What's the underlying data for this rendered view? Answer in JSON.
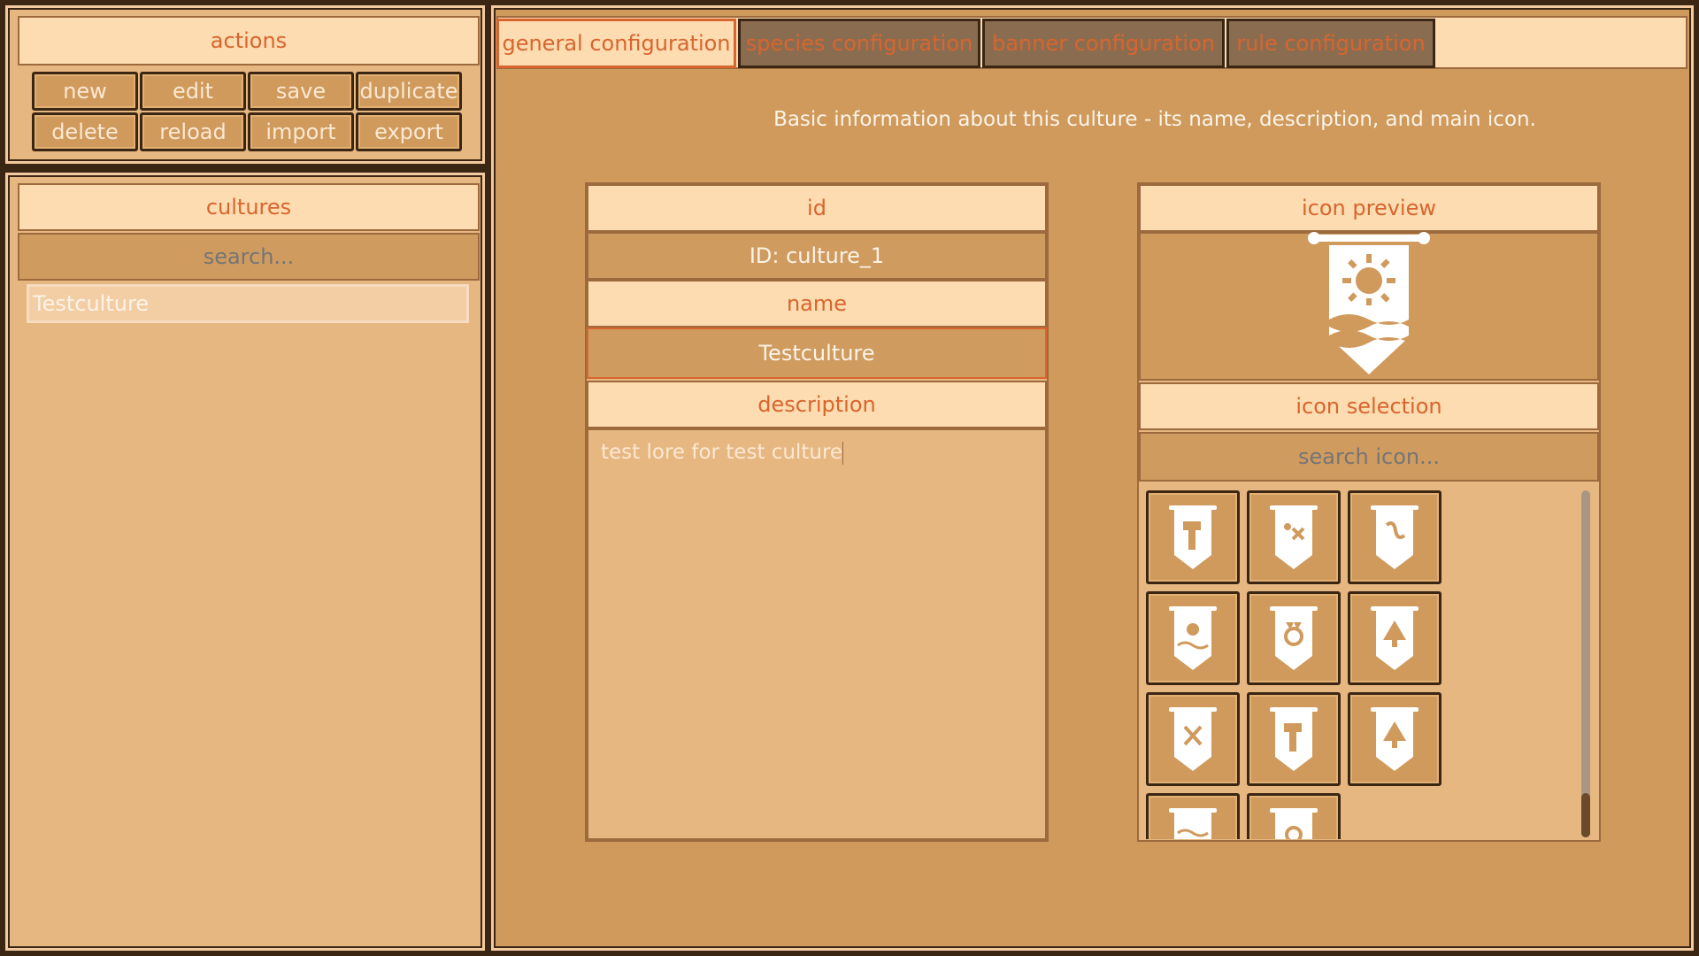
{
  "actions": {
    "title": "actions",
    "buttons": [
      "new",
      "edit",
      "save",
      "duplicate",
      "delete",
      "reload",
      "import",
      "export"
    ]
  },
  "cultures": {
    "title": "cultures",
    "search_placeholder": "search...",
    "items": [
      "Testculture"
    ]
  },
  "tabs": [
    "general configuration",
    "species configuration",
    "banner configuration",
    "rule configuration"
  ],
  "general": {
    "info_text": "Basic information about this culture - its name, description, and main icon.",
    "id_label": "id",
    "id_value": "ID: culture_1",
    "name_label": "name",
    "name_value": "Testculture",
    "description_label": "description",
    "description_value": "test lore for test culture",
    "icon_preview_label": "icon preview",
    "icon_preview_name": "banner-sun-waves-icon",
    "icon_selection_label": "icon selection",
    "icon_search_placeholder": "search icon...",
    "icons": [
      "banner-hammer-icon",
      "banner-bones-icon",
      "banner-scroll-icon",
      "banner-sun-waves-icon",
      "banner-crown-wreath-icon",
      "banner-tree-icon",
      "banner-bone-cross-icon",
      "banner-hammer-icon",
      "banner-tree-icon",
      "banner-waves-icon",
      "banner-circle-icon"
    ]
  },
  "colors": {
    "background": "#cf9a5c",
    "panel": "#e7b781",
    "header": "#fcdcb0",
    "accent": "#d9652e",
    "field": "#d09b5f",
    "dark_border": "#3b2614"
  }
}
